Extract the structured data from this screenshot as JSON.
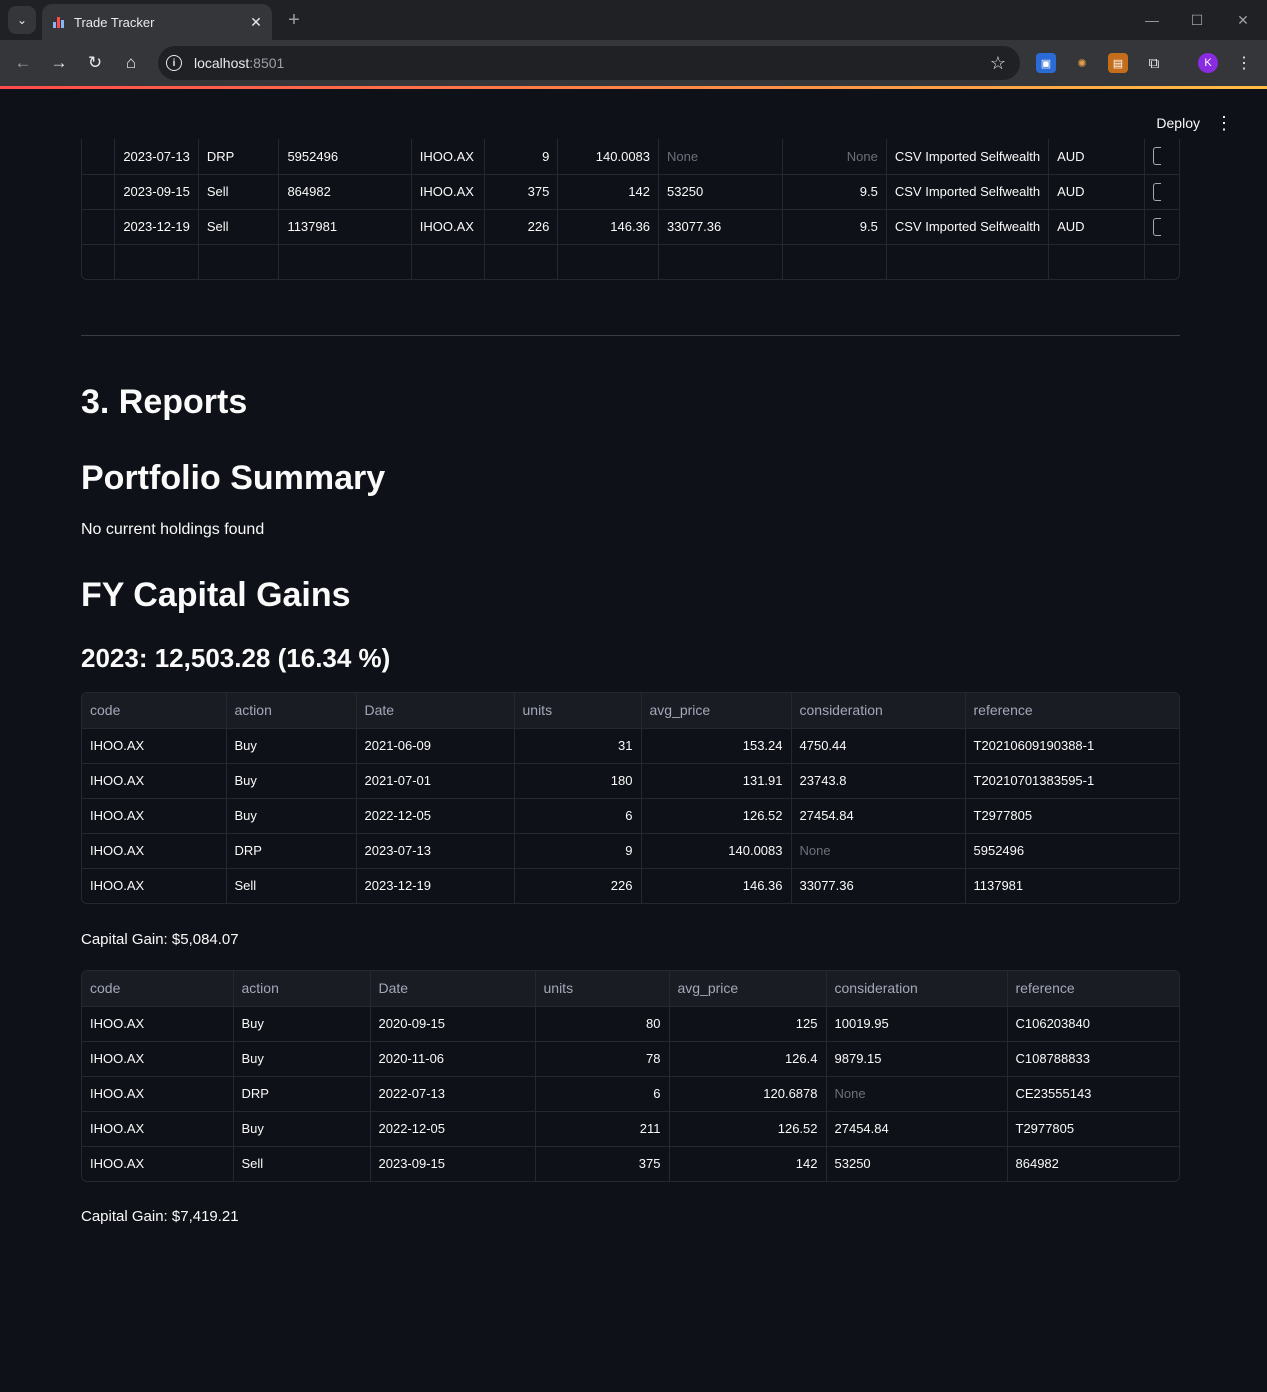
{
  "browser": {
    "tab_title": "Trade Tracker",
    "url_host": "localhost",
    "url_port": ":8501",
    "profile_initial": "K"
  },
  "app": {
    "deploy_label": "Deploy"
  },
  "trades_table": {
    "rows": [
      [
        "2023-07-13",
        "DRP",
        "5952496",
        "IHOO.AX",
        "9",
        "140.0083",
        "None",
        "None",
        "CSV Imported Selfwealth",
        "AUD"
      ],
      [
        "2023-09-15",
        "Sell",
        "864982",
        "IHOO.AX",
        "375",
        "142",
        "53250",
        "9.5",
        "CSV Imported Selfwealth",
        "AUD"
      ],
      [
        "2023-12-19",
        "Sell",
        "1137981",
        "IHOO.AX",
        "226",
        "146.36",
        "33077.36",
        "9.5",
        "CSV Imported Selfwealth",
        "AUD"
      ]
    ]
  },
  "reports": {
    "heading": "3. Reports",
    "portfolio_heading": "Portfolio Summary",
    "portfolio_text": "No current holdings found",
    "fy_heading": "FY Capital Gains",
    "year_heading": "2023: 12,503.28 (16.34 %)",
    "columns": [
      "code",
      "action",
      "Date",
      "units",
      "avg_price",
      "consideration",
      "reference"
    ],
    "table1": [
      [
        "IHOO.AX",
        "Buy",
        "2021-06-09",
        "31",
        "153.24",
        "4750.44",
        "T20210609190388-1"
      ],
      [
        "IHOO.AX",
        "Buy",
        "2021-07-01",
        "180",
        "131.91",
        "23743.8",
        "T20210701383595-1"
      ],
      [
        "IHOO.AX",
        "Buy",
        "2022-12-05",
        "6",
        "126.52",
        "27454.84",
        "T2977805"
      ],
      [
        "IHOO.AX",
        "DRP",
        "2023-07-13",
        "9",
        "140.0083",
        "None",
        "5952496"
      ],
      [
        "IHOO.AX",
        "Sell",
        "2023-12-19",
        "226",
        "146.36",
        "33077.36",
        "1137981"
      ]
    ],
    "gain1": "Capital Gain: $5,084.07",
    "table2": [
      [
        "IHOO.AX",
        "Buy",
        "2020-09-15",
        "80",
        "125",
        "10019.95",
        "C106203840"
      ],
      [
        "IHOO.AX",
        "Buy",
        "2020-11-06",
        "78",
        "126.4",
        "9879.15",
        "C108788833"
      ],
      [
        "IHOO.AX",
        "DRP",
        "2022-07-13",
        "6",
        "120.6878",
        "None",
        "CE23555143"
      ],
      [
        "IHOO.AX",
        "Buy",
        "2022-12-05",
        "211",
        "126.52",
        "27454.84",
        "T2977805"
      ],
      [
        "IHOO.AX",
        "Sell",
        "2023-09-15",
        "375",
        "142",
        "53250",
        "864982"
      ]
    ],
    "gain2": "Capital Gain: $7,419.21"
  }
}
